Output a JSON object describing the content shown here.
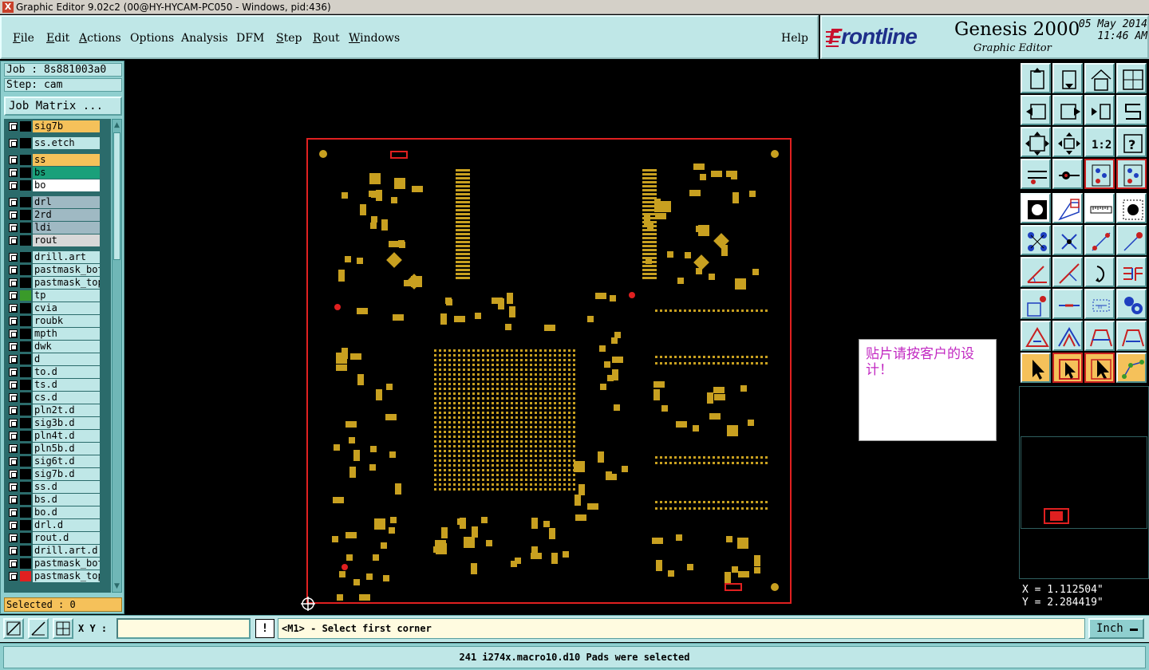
{
  "window": {
    "title": "Graphic Editor 9.02c2 (00@HY-HYCAM-PC050 - Windows, pid:436)"
  },
  "menu": {
    "items": [
      {
        "label": "File",
        "hotkey": "F"
      },
      {
        "label": "Edit",
        "hotkey": "E"
      },
      {
        "label": "Actions",
        "hotkey": "A"
      },
      {
        "label": "Options",
        "hotkey": ""
      },
      {
        "label": "Analysis",
        "hotkey": ""
      },
      {
        "label": "DFM",
        "hotkey": ""
      },
      {
        "label": "Step",
        "hotkey": "S"
      },
      {
        "label": "Rout",
        "hotkey": "R"
      },
      {
        "label": "Windows",
        "hotkey": "W"
      }
    ],
    "help": "Help"
  },
  "brand": {
    "logo": "Frontline",
    "product": "Genesis 2000",
    "subtitle": "Graphic Editor",
    "date": "05 May 2014",
    "time": "11:46 AM"
  },
  "job": {
    "job_line": "Job : 8s881003a0",
    "step_line": "Step: cam",
    "matrix_button": "Job Matrix ...",
    "selected": "Selected : 0"
  },
  "layers": [
    {
      "name": "sig7b",
      "bg": "#f5c15a",
      "sw": "#000000"
    },
    {
      "name": "ss.etch",
      "bg": "#bfe7e7",
      "sw": "#000000"
    },
    {
      "name": "ss",
      "bg": "#f5c15a",
      "sw": "#000000"
    },
    {
      "name": "bs",
      "bg": "#1aa07a",
      "sw": "#000000"
    },
    {
      "name": "bo",
      "bg": "#ffffff",
      "sw": "#000000"
    },
    {
      "name": "drl",
      "bg": "#9fb9c3",
      "sw": "#000000"
    },
    {
      "name": "2rd",
      "bg": "#9fb9c3",
      "sw": "#000000"
    },
    {
      "name": "ldi",
      "bg": "#9fb9c3",
      "sw": "#000000"
    },
    {
      "name": "rout",
      "bg": "#d8d8d8",
      "sw": "#000000"
    },
    {
      "name": "drill.art",
      "bg": "#bfe7e7",
      "sw": "#000000"
    },
    {
      "name": "pastmask_bot",
      "bg": "#bfe7e7",
      "sw": "#000000"
    },
    {
      "name": "pastmask_top",
      "bg": "#bfe7e7",
      "sw": "#000000"
    },
    {
      "name": "tp",
      "bg": "#bfe7e7",
      "sw": "#3a9a2a"
    },
    {
      "name": "cvia",
      "bg": "#bfe7e7",
      "sw": "#000000"
    },
    {
      "name": "roubk",
      "bg": "#bfe7e7",
      "sw": "#000000"
    },
    {
      "name": "mpth",
      "bg": "#bfe7e7",
      "sw": "#000000"
    },
    {
      "name": "dwk",
      "bg": "#bfe7e7",
      "sw": "#000000"
    },
    {
      "name": "d",
      "bg": "#bfe7e7",
      "sw": "#000000"
    },
    {
      "name": "to.d",
      "bg": "#bfe7e7",
      "sw": "#000000"
    },
    {
      "name": "ts.d",
      "bg": "#bfe7e7",
      "sw": "#000000"
    },
    {
      "name": "cs.d",
      "bg": "#bfe7e7",
      "sw": "#000000"
    },
    {
      "name": "pln2t.d",
      "bg": "#bfe7e7",
      "sw": "#000000"
    },
    {
      "name": "sig3b.d",
      "bg": "#bfe7e7",
      "sw": "#000000"
    },
    {
      "name": "pln4t.d",
      "bg": "#bfe7e7",
      "sw": "#000000"
    },
    {
      "name": "pln5b.d",
      "bg": "#bfe7e7",
      "sw": "#000000"
    },
    {
      "name": "sig6t.d",
      "bg": "#bfe7e7",
      "sw": "#000000"
    },
    {
      "name": "sig7b.d",
      "bg": "#bfe7e7",
      "sw": "#000000"
    },
    {
      "name": "ss.d",
      "bg": "#bfe7e7",
      "sw": "#000000"
    },
    {
      "name": "bs.d",
      "bg": "#bfe7e7",
      "sw": "#000000"
    },
    {
      "name": "bo.d",
      "bg": "#bfe7e7",
      "sw": "#000000"
    },
    {
      "name": "drl.d",
      "bg": "#bfe7e7",
      "sw": "#000000"
    },
    {
      "name": "rout.d",
      "bg": "#bfe7e7",
      "sw": "#000000"
    },
    {
      "name": "drill.art.d",
      "bg": "#bfe7e7",
      "sw": "#000000"
    },
    {
      "name": "pastmask_bot",
      "bg": "#bfe7e7",
      "sw": "#000000"
    },
    {
      "name": "pastmask_top",
      "bg": "#bfe7e7",
      "sw": "#e02020"
    }
  ],
  "canvas": {
    "note": "贴片请按客户的设计！",
    "pad_color": "#c8a020",
    "outline_color": "#e02020"
  },
  "coords": {
    "x": "X = 1.112504\"",
    "y": "Y = 2.284419\""
  },
  "bottom": {
    "xy_label": "X Y :",
    "xy_value": "",
    "prompt": "<M1> - Select first corner",
    "unit": "Inch"
  },
  "status": {
    "message": "241 i274x.macro10.d10 Pads were selected"
  },
  "toolbar_icons": [
    "pan-up-icon",
    "pan-down-icon",
    "home-icon",
    "split-view-icon",
    "pan-left-icon",
    "pan-right-icon",
    "mirror-icon",
    "s-curve-icon",
    "fit-all-icon",
    "fit-center-icon",
    "ratio-one-to-two-icon",
    "help-icon",
    "measure-tools-icon",
    "snap-icon",
    "layers-panel-icon",
    "layers-panel-red-icon",
    "select-pad-icon",
    "select-line-icon",
    "ruler-icon",
    "circle-pad-icon",
    "net-select-icon",
    "cross-select-icon",
    "connect-points-icon",
    "endpoint-icon",
    "angle-icon",
    "slope-icon",
    "arc-icon",
    "split-feature-icon",
    "point-red-icon",
    "line-segment-icon",
    "dimension-icon",
    "cluster-icon",
    "triangle-icon",
    "triangle-up-icon",
    "triangle-bridge-icon",
    "triangle-cross-icon",
    "pointer-icon",
    "pointer-box-icon",
    "pointer-select-icon",
    "node-edit-icon"
  ]
}
